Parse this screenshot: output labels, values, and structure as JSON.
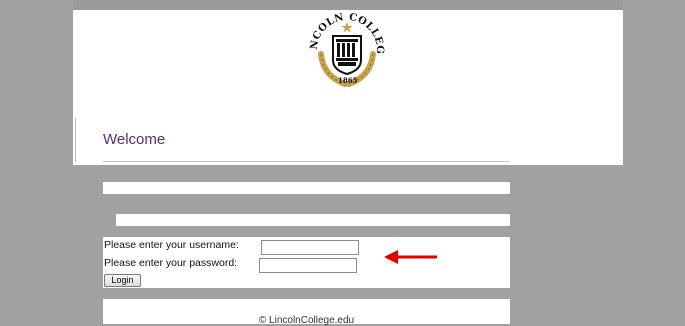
{
  "header": {
    "logo_text": "LINCOLN COLLEGE",
    "logo_year": "1865",
    "welcome_title": "Welcome"
  },
  "login": {
    "username_label": "Please enter your username:",
    "password_label": "Please enter your password:",
    "username_value": "",
    "password_value": "",
    "login_button_label": "Login"
  },
  "annotation": {
    "arrow_color": "#e00000",
    "arrow_icon": "arrow-left-icon"
  },
  "footer": {
    "copyright": "© LincolnCollege.edu"
  },
  "colors": {
    "background": "#a1a1a1",
    "welcome_text": "#5a2d6e",
    "seal_gold": "#c8a24a"
  }
}
